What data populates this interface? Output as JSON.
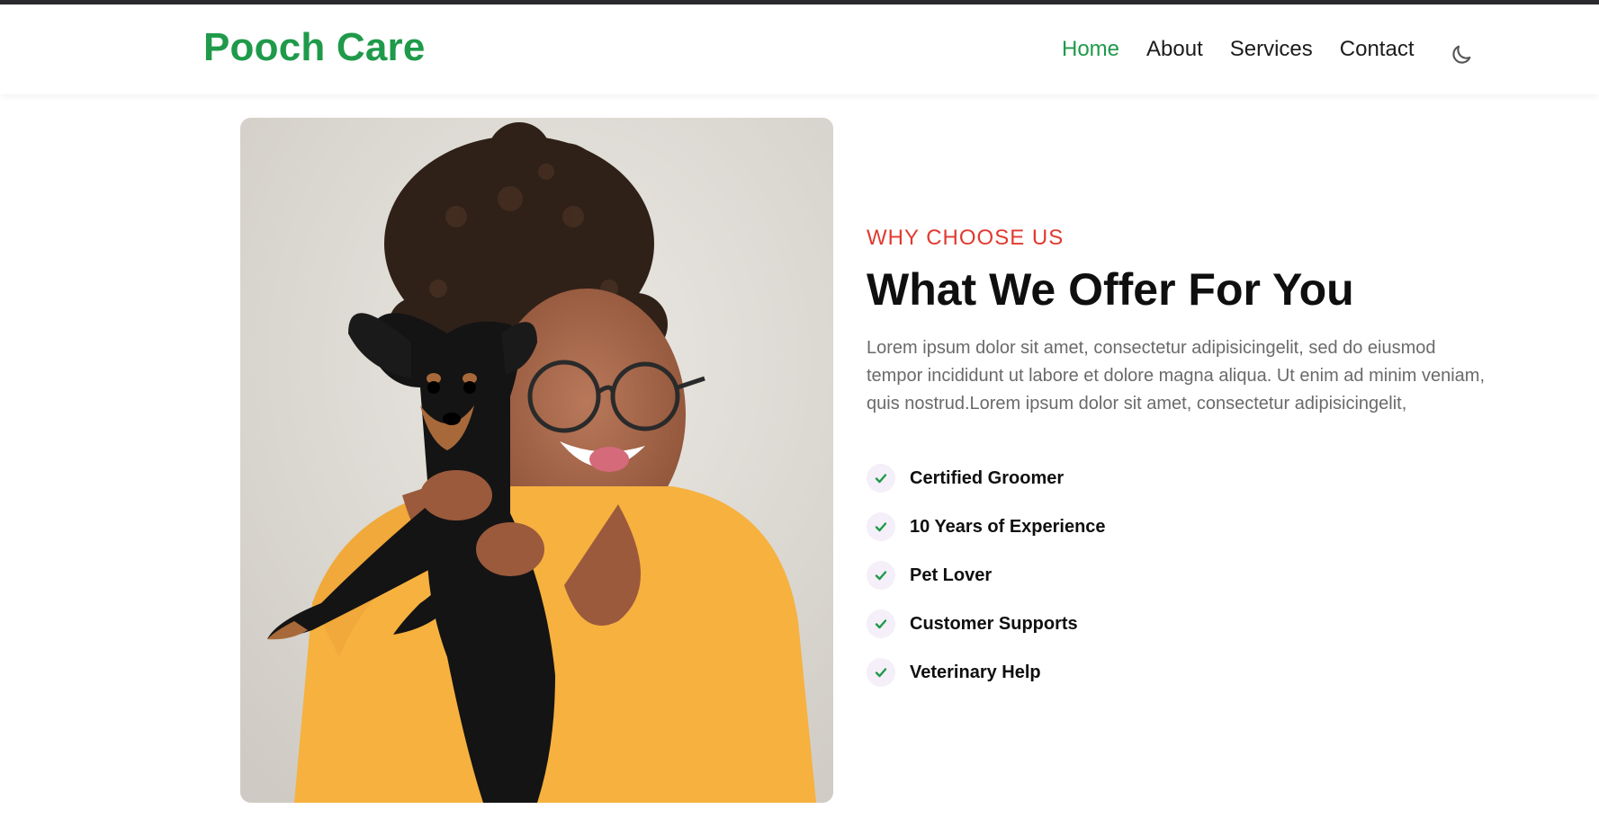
{
  "header": {
    "brand": "Pooch Care",
    "nav": [
      {
        "label": "Home",
        "active": true
      },
      {
        "label": "About",
        "active": false
      },
      {
        "label": "Services",
        "active": false
      },
      {
        "label": "Contact",
        "active": false
      }
    ],
    "theme_icon": "moon-icon"
  },
  "section": {
    "eyebrow": "WHY CHOOSE US",
    "title": "What We Offer For You",
    "description": "Lorem ipsum dolor sit amet, consectetur adipisicingelit, sed do eiusmod tempor incididunt ut labore et dolore magna aliqua. Ut enim ad minim veniam, quis nostrud.Lorem ipsum dolor sit amet, consectetur adipisicingelit,",
    "features": [
      {
        "label": "Certified Groomer",
        "icon": "check-icon"
      },
      {
        "label": "10 Years of Experience",
        "icon": "check-icon"
      },
      {
        "label": "Pet Lover",
        "icon": "check-icon"
      },
      {
        "label": "Customer Supports",
        "icon": "check-icon"
      },
      {
        "label": "Veterinary Help",
        "icon": "check-icon"
      }
    ],
    "image_icon": "woman-holding-dog-photo"
  },
  "colors": {
    "brand": "#1f9a4a",
    "accent_red": "#e03a2f",
    "topbar": "#2b2b2e",
    "text_dark": "#0f0f0f",
    "text_muted": "#6a6a6a",
    "check_bg": "#f4eff8"
  }
}
